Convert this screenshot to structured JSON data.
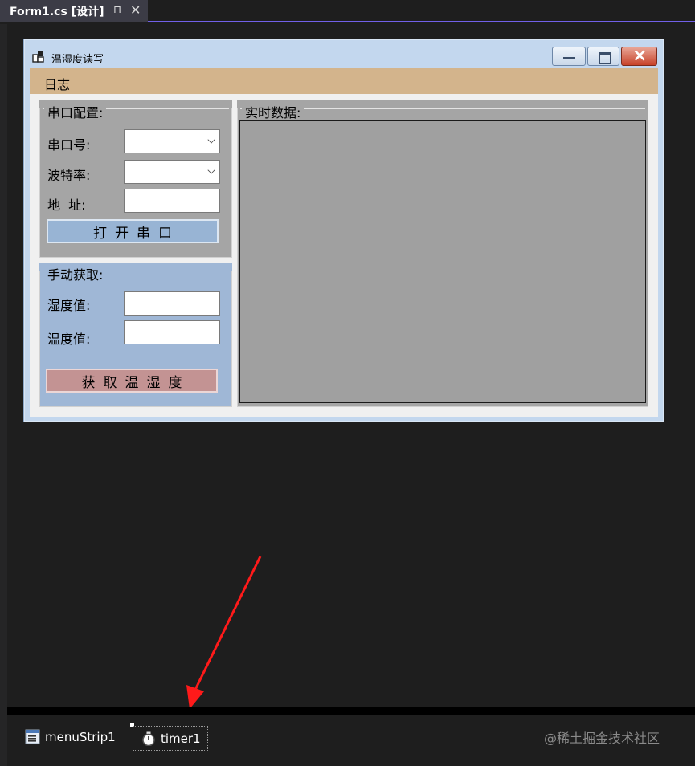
{
  "ide": {
    "tab_title": "Form1.cs [设计]",
    "pin_glyph": "⊓",
    "close_glyph": "✕"
  },
  "form": {
    "caption": "温湿度读写",
    "menu": {
      "log_label": "日志"
    },
    "serial_group": {
      "title": "串口配置:",
      "port_label": "串口号:",
      "port_value": "",
      "baud_label": "波特率:",
      "baud_value": "",
      "address_label": "地  址:",
      "address_value": "",
      "open_button": "打开串口"
    },
    "manual_group": {
      "title": "手动获取:",
      "humidity_label": "湿度值:",
      "humidity_value": "",
      "temperature_label": "温度值:",
      "temperature_value": "",
      "get_button": "获取温湿度"
    },
    "realtime_group": {
      "title": "实时数据:"
    }
  },
  "tray": {
    "menustrip_label": "menuStrip1",
    "timer_label": "timer1"
  },
  "watermark": "@稀土掘金技术社区",
  "colors": {
    "accent_line": "#7160e8",
    "menustrip": "#d3b48c",
    "serial_group_bg": "#a5a5a5",
    "manual_group_bg": "#9fb7d6",
    "open_button_bg": "#98b4d4",
    "get_button_bg": "#c39393",
    "annotation_arrow": "#ff1a1a"
  }
}
